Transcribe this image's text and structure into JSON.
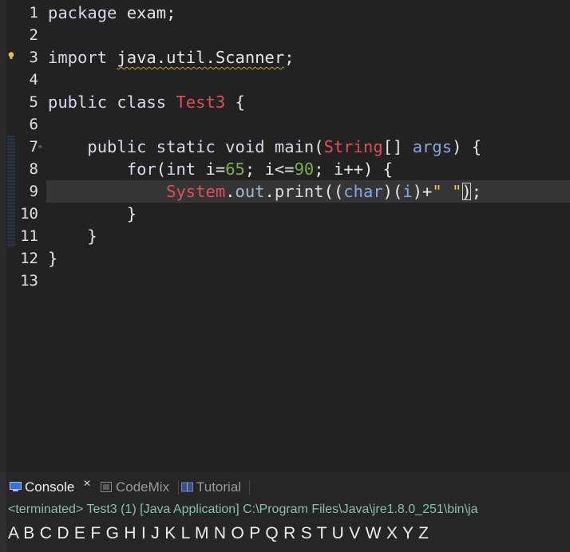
{
  "editor": {
    "line_numbers": [
      "1",
      "2",
      "3",
      "4",
      "5",
      "6",
      "7",
      "8",
      "9",
      "10",
      "11",
      "12",
      "13"
    ],
    "lines": {
      "l1": {
        "kw": "package",
        "rest": " exam;"
      },
      "l3": {
        "kw": "import",
        "pkg": "java.util.Scanner",
        "semi": ";"
      },
      "l5": {
        "kw": "public class",
        "cls": "Test3",
        "brace": " {"
      },
      "l7": {
        "kw": "public static void",
        "method": "main",
        "open": "(",
        "type": "String",
        "arr": "[]",
        "param": "args",
        "close": ") {"
      },
      "l8": {
        "kw": "for",
        "p1": "(",
        "type": "int",
        "v1": "i",
        "eq": "=",
        "n1": "65",
        "semi1": "; ",
        "v2": "i",
        "le": "<=",
        "n2": "90",
        "semi2": "; ",
        "v3": "i",
        "inc": "++) {"
      },
      "l9": {
        "sys": "System",
        "dot1": ".",
        "out": "out",
        "dot2": ".",
        "print": "print",
        "p1": "((",
        "char": "char",
        "p2": ")(",
        "var": "i",
        "p3": ")+",
        "str": "\" \"",
        "p4": ")",
        "semi": ";"
      },
      "l10": {
        "text": "}"
      },
      "l11": {
        "text": "}"
      },
      "l12": {
        "text": "}"
      }
    }
  },
  "console": {
    "tabs": [
      {
        "label": "Console",
        "close": "✕"
      },
      {
        "label": "CodeMix"
      },
      {
        "label": "Tutorial"
      }
    ],
    "status": "<terminated> Test3 (1) [Java Application] C:\\Program Files\\Java\\jre1.8.0_251\\bin\\ja",
    "output": "A B C D E F G H I J K L M N O P Q R S T U V W X Y Z"
  },
  "colors": {
    "background": "#222222",
    "keyword": "#d8d8e8",
    "class_name": "#e04f4f",
    "number": "#79ae4a",
    "string": "#f4c542",
    "variable": "#81a9e6",
    "status_text": "#7fc3b0"
  },
  "icons": [
    "lightbulb-icon",
    "fold-collapse-icon",
    "console-icon",
    "codemix-icon",
    "tutorial-icon",
    "close-icon"
  ]
}
